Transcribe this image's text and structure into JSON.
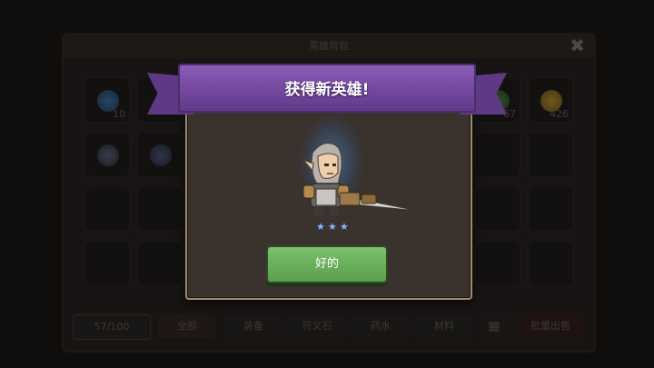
{
  "inventory": {
    "title": "英雄背包",
    "capacity": "57/100",
    "slot_counts": [
      "10",
      "67",
      "426"
    ],
    "tabs": [
      "全部",
      "装备",
      "符文石",
      "药水",
      "材料"
    ],
    "batch_sell_label": "批量出售"
  },
  "dialog": {
    "title": "获得新英雄!",
    "ok_label": "好的",
    "hero_stars": 3
  },
  "colors": {
    "ribbon": "#74479f",
    "button": "#6aaf5b",
    "modal_border": "#9c8a6b"
  }
}
